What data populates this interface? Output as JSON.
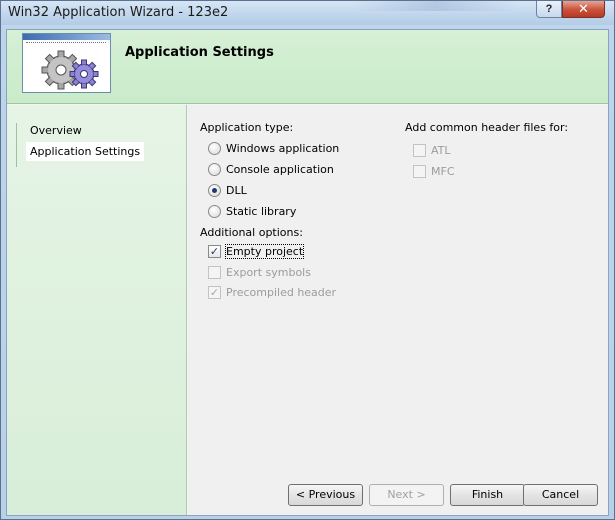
{
  "window": {
    "title": "Win32 Application Wizard - 123e2",
    "help_glyph": "?",
    "close_glyph": "✕"
  },
  "header": {
    "title": "Application Settings"
  },
  "nav": {
    "items": [
      {
        "label": "Overview"
      },
      {
        "label": "Application Settings"
      }
    ]
  },
  "app_type": {
    "label": "Application type:",
    "options": [
      {
        "label": "Windows application",
        "selected": false
      },
      {
        "label": "Console application",
        "selected": false
      },
      {
        "label": "DLL",
        "selected": true
      },
      {
        "label": "Static library",
        "selected": false
      }
    ]
  },
  "additional": {
    "label": "Additional options:",
    "options": [
      {
        "label": "Empty project",
        "checked": true,
        "enabled": true
      },
      {
        "label": "Export symbols",
        "checked": false,
        "enabled": false
      },
      {
        "label": "Precompiled header",
        "checked": true,
        "enabled": false
      }
    ]
  },
  "headers": {
    "label": "Add common header files for:",
    "options": [
      {
        "label": "ATL",
        "checked": false,
        "enabled": false
      },
      {
        "label": "MFC",
        "checked": false,
        "enabled": false
      }
    ]
  },
  "buttons": {
    "previous": "< Previous",
    "next": "Next >",
    "finish": "Finish",
    "cancel": "Cancel"
  }
}
